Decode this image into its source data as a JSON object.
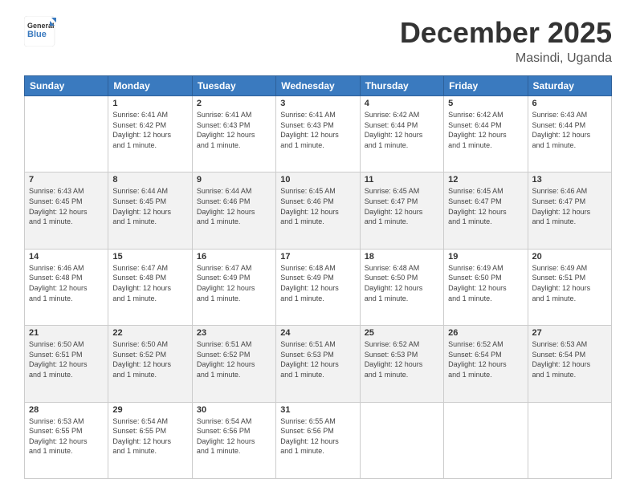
{
  "header": {
    "logo_general": "General",
    "logo_blue": "Blue",
    "month": "December 2025",
    "location": "Masindi, Uganda"
  },
  "weekdays": [
    "Sunday",
    "Monday",
    "Tuesday",
    "Wednesday",
    "Thursday",
    "Friday",
    "Saturday"
  ],
  "weeks": [
    [
      {
        "day": "",
        "sunrise": "",
        "sunset": "",
        "daylight": ""
      },
      {
        "day": "1",
        "sunrise": "6:41 AM",
        "sunset": "6:42 PM",
        "daylight": "12 hours and 1 minute."
      },
      {
        "day": "2",
        "sunrise": "6:41 AM",
        "sunset": "6:43 PM",
        "daylight": "12 hours and 1 minute."
      },
      {
        "day": "3",
        "sunrise": "6:41 AM",
        "sunset": "6:43 PM",
        "daylight": "12 hours and 1 minute."
      },
      {
        "day": "4",
        "sunrise": "6:42 AM",
        "sunset": "6:44 PM",
        "daylight": "12 hours and 1 minute."
      },
      {
        "day": "5",
        "sunrise": "6:42 AM",
        "sunset": "6:44 PM",
        "daylight": "12 hours and 1 minute."
      },
      {
        "day": "6",
        "sunrise": "6:43 AM",
        "sunset": "6:44 PM",
        "daylight": "12 hours and 1 minute."
      }
    ],
    [
      {
        "day": "7",
        "sunrise": "6:43 AM",
        "sunset": "6:45 PM",
        "daylight": "12 hours and 1 minute."
      },
      {
        "day": "8",
        "sunrise": "6:44 AM",
        "sunset": "6:45 PM",
        "daylight": "12 hours and 1 minute."
      },
      {
        "day": "9",
        "sunrise": "6:44 AM",
        "sunset": "6:46 PM",
        "daylight": "12 hours and 1 minute."
      },
      {
        "day": "10",
        "sunrise": "6:45 AM",
        "sunset": "6:46 PM",
        "daylight": "12 hours and 1 minute."
      },
      {
        "day": "11",
        "sunrise": "6:45 AM",
        "sunset": "6:47 PM",
        "daylight": "12 hours and 1 minute."
      },
      {
        "day": "12",
        "sunrise": "6:45 AM",
        "sunset": "6:47 PM",
        "daylight": "12 hours and 1 minute."
      },
      {
        "day": "13",
        "sunrise": "6:46 AM",
        "sunset": "6:47 PM",
        "daylight": "12 hours and 1 minute."
      }
    ],
    [
      {
        "day": "14",
        "sunrise": "6:46 AM",
        "sunset": "6:48 PM",
        "daylight": "12 hours and 1 minute."
      },
      {
        "day": "15",
        "sunrise": "6:47 AM",
        "sunset": "6:48 PM",
        "daylight": "12 hours and 1 minute."
      },
      {
        "day": "16",
        "sunrise": "6:47 AM",
        "sunset": "6:49 PM",
        "daylight": "12 hours and 1 minute."
      },
      {
        "day": "17",
        "sunrise": "6:48 AM",
        "sunset": "6:49 PM",
        "daylight": "12 hours and 1 minute."
      },
      {
        "day": "18",
        "sunrise": "6:48 AM",
        "sunset": "6:50 PM",
        "daylight": "12 hours and 1 minute."
      },
      {
        "day": "19",
        "sunrise": "6:49 AM",
        "sunset": "6:50 PM",
        "daylight": "12 hours and 1 minute."
      },
      {
        "day": "20",
        "sunrise": "6:49 AM",
        "sunset": "6:51 PM",
        "daylight": "12 hours and 1 minute."
      }
    ],
    [
      {
        "day": "21",
        "sunrise": "6:50 AM",
        "sunset": "6:51 PM",
        "daylight": "12 hours and 1 minute."
      },
      {
        "day": "22",
        "sunrise": "6:50 AM",
        "sunset": "6:52 PM",
        "daylight": "12 hours and 1 minute."
      },
      {
        "day": "23",
        "sunrise": "6:51 AM",
        "sunset": "6:52 PM",
        "daylight": "12 hours and 1 minute."
      },
      {
        "day": "24",
        "sunrise": "6:51 AM",
        "sunset": "6:53 PM",
        "daylight": "12 hours and 1 minute."
      },
      {
        "day": "25",
        "sunrise": "6:52 AM",
        "sunset": "6:53 PM",
        "daylight": "12 hours and 1 minute."
      },
      {
        "day": "26",
        "sunrise": "6:52 AM",
        "sunset": "6:54 PM",
        "daylight": "12 hours and 1 minute."
      },
      {
        "day": "27",
        "sunrise": "6:53 AM",
        "sunset": "6:54 PM",
        "daylight": "12 hours and 1 minute."
      }
    ],
    [
      {
        "day": "28",
        "sunrise": "6:53 AM",
        "sunset": "6:55 PM",
        "daylight": "12 hours and 1 minute."
      },
      {
        "day": "29",
        "sunrise": "6:54 AM",
        "sunset": "6:55 PM",
        "daylight": "12 hours and 1 minute."
      },
      {
        "day": "30",
        "sunrise": "6:54 AM",
        "sunset": "6:56 PM",
        "daylight": "12 hours and 1 minute."
      },
      {
        "day": "31",
        "sunrise": "6:55 AM",
        "sunset": "6:56 PM",
        "daylight": "12 hours and 1 minute."
      },
      {
        "day": "",
        "sunrise": "",
        "sunset": "",
        "daylight": ""
      },
      {
        "day": "",
        "sunrise": "",
        "sunset": "",
        "daylight": ""
      },
      {
        "day": "",
        "sunrise": "",
        "sunset": "",
        "daylight": ""
      }
    ]
  ],
  "labels": {
    "sunrise_prefix": "Sunrise: ",
    "sunset_prefix": "Sunset: ",
    "daylight_prefix": "Daylight: "
  }
}
